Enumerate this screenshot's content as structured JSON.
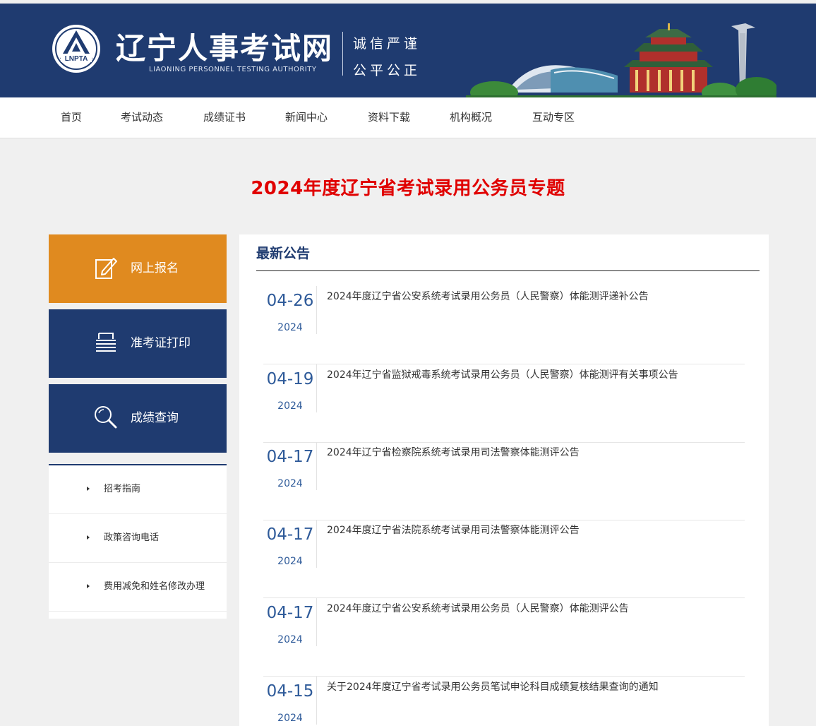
{
  "header": {
    "logo_emblem_text": "LNPTA",
    "site_title": "辽宁人事考试网",
    "site_subtitle": "LIAONING PERSONNEL TESTING AUTHORITY",
    "motto_line1": "诚信严谨",
    "motto_line2": "公平公正",
    "brand_color": "#1f3b70"
  },
  "nav": {
    "items": [
      {
        "label": "首页"
      },
      {
        "label": "考试动态"
      },
      {
        "label": "成绩证书"
      },
      {
        "label": "新闻中心"
      },
      {
        "label": "资料下载"
      },
      {
        "label": "机构概况"
      },
      {
        "label": "互动专区"
      }
    ]
  },
  "page": {
    "title": "2024年度辽宁省考试录用公务员专题",
    "title_color": "#e00000"
  },
  "sidebar": {
    "buttons": [
      {
        "label": "网上报名",
        "icon": "edit-icon",
        "color": "#e08a1f"
      },
      {
        "label": "准考证打印",
        "icon": "printer-icon",
        "color": "#1f3b70"
      },
      {
        "label": "成绩查询",
        "icon": "search-icon",
        "color": "#1f3b70"
      }
    ],
    "links": [
      {
        "label": "招考指南"
      },
      {
        "label": "政策咨询电话"
      },
      {
        "label": "费用减免和姓名修改办理"
      }
    ]
  },
  "notices": {
    "heading": "最新公告",
    "items": [
      {
        "day": "04-26",
        "year": "2024",
        "title": "2024年度辽宁省公安系统考试录用公务员（人民警察）体能测评递补公告"
      },
      {
        "day": "04-19",
        "year": "2024",
        "title": "2024年辽宁省监狱戒毒系统考试录用公务员（人民警察）体能测评有关事项公告"
      },
      {
        "day": "04-17",
        "year": "2024",
        "title": "2024年辽宁省检察院系统考试录用司法警察体能测评公告"
      },
      {
        "day": "04-17",
        "year": "2024",
        "title": "2024年度辽宁省法院系统考试录用司法警察体能测评公告"
      },
      {
        "day": "04-17",
        "year": "2024",
        "title": "2024年度辽宁省公安系统考试录用公务员（人民警察）体能测评公告"
      },
      {
        "day": "04-15",
        "year": "2024",
        "title": "关于2024年度辽宁省考试录用公务员笔试申论科目成绩复核结果查询的通知"
      }
    ]
  }
}
